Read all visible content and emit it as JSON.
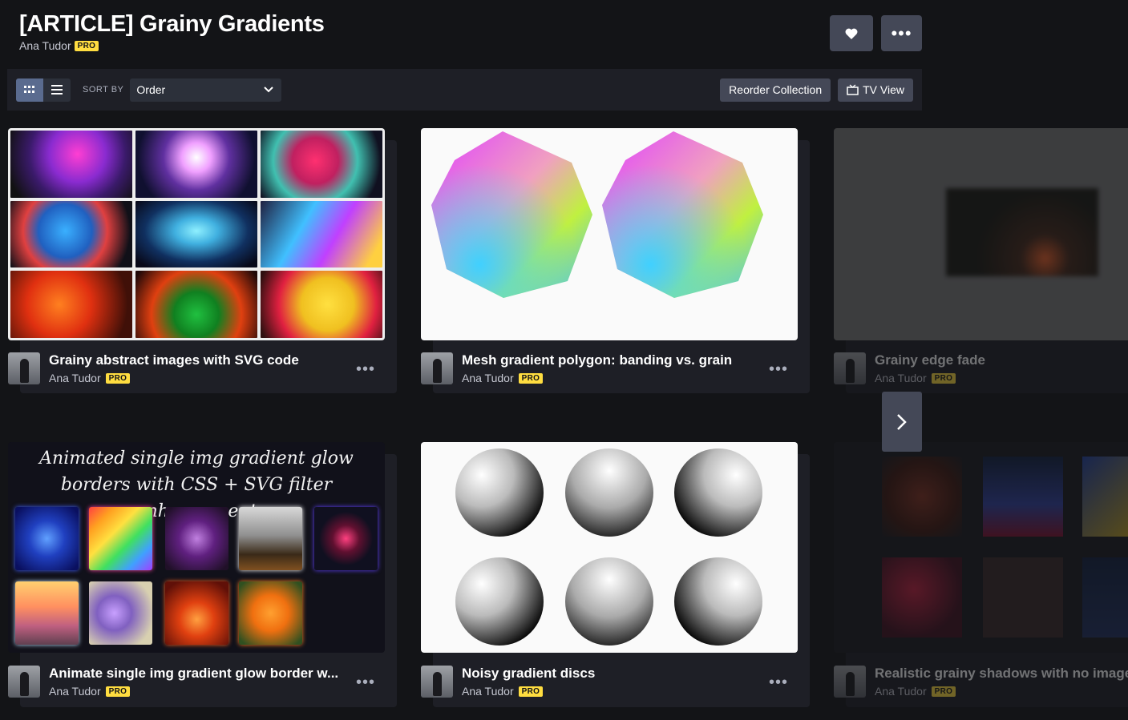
{
  "header": {
    "title": "[ARTICLE] Grainy Gradients",
    "author": "Ana Tudor",
    "badge": "PRO",
    "heart_icon": "heart-icon",
    "more_icon": "more-icon"
  },
  "toolbar": {
    "sort_label": "SORT BY",
    "sort_value": "Order",
    "reorder_label": "Reorder Collection",
    "tv_label": "TV View"
  },
  "cards": [
    {
      "title": "Grainy abstract images with SVG code",
      "author": "Ana Tudor",
      "badge": "PRO"
    },
    {
      "title": "Mesh gradient polygon: banding vs. grain",
      "author": "Ana Tudor",
      "badge": "PRO"
    },
    {
      "title": "Grainy edge fade",
      "author": "Ana Tudor",
      "badge": "PRO"
    },
    {
      "title": "Animate single img gradient glow border w...",
      "author": "Ana Tudor",
      "badge": "PRO",
      "thumb_text": "Animated single img gradient glow borders with CSS + SVG filter enhancement"
    },
    {
      "title": "Noisy gradient discs",
      "author": "Ana Tudor",
      "badge": "PRO"
    },
    {
      "title": "Realistic grainy shadows with no image d",
      "author": "Ana Tudor",
      "badge": "PRO"
    }
  ],
  "colors": {
    "accent": "#ffdd40",
    "bg": "#131417",
    "button": "#444857"
  }
}
